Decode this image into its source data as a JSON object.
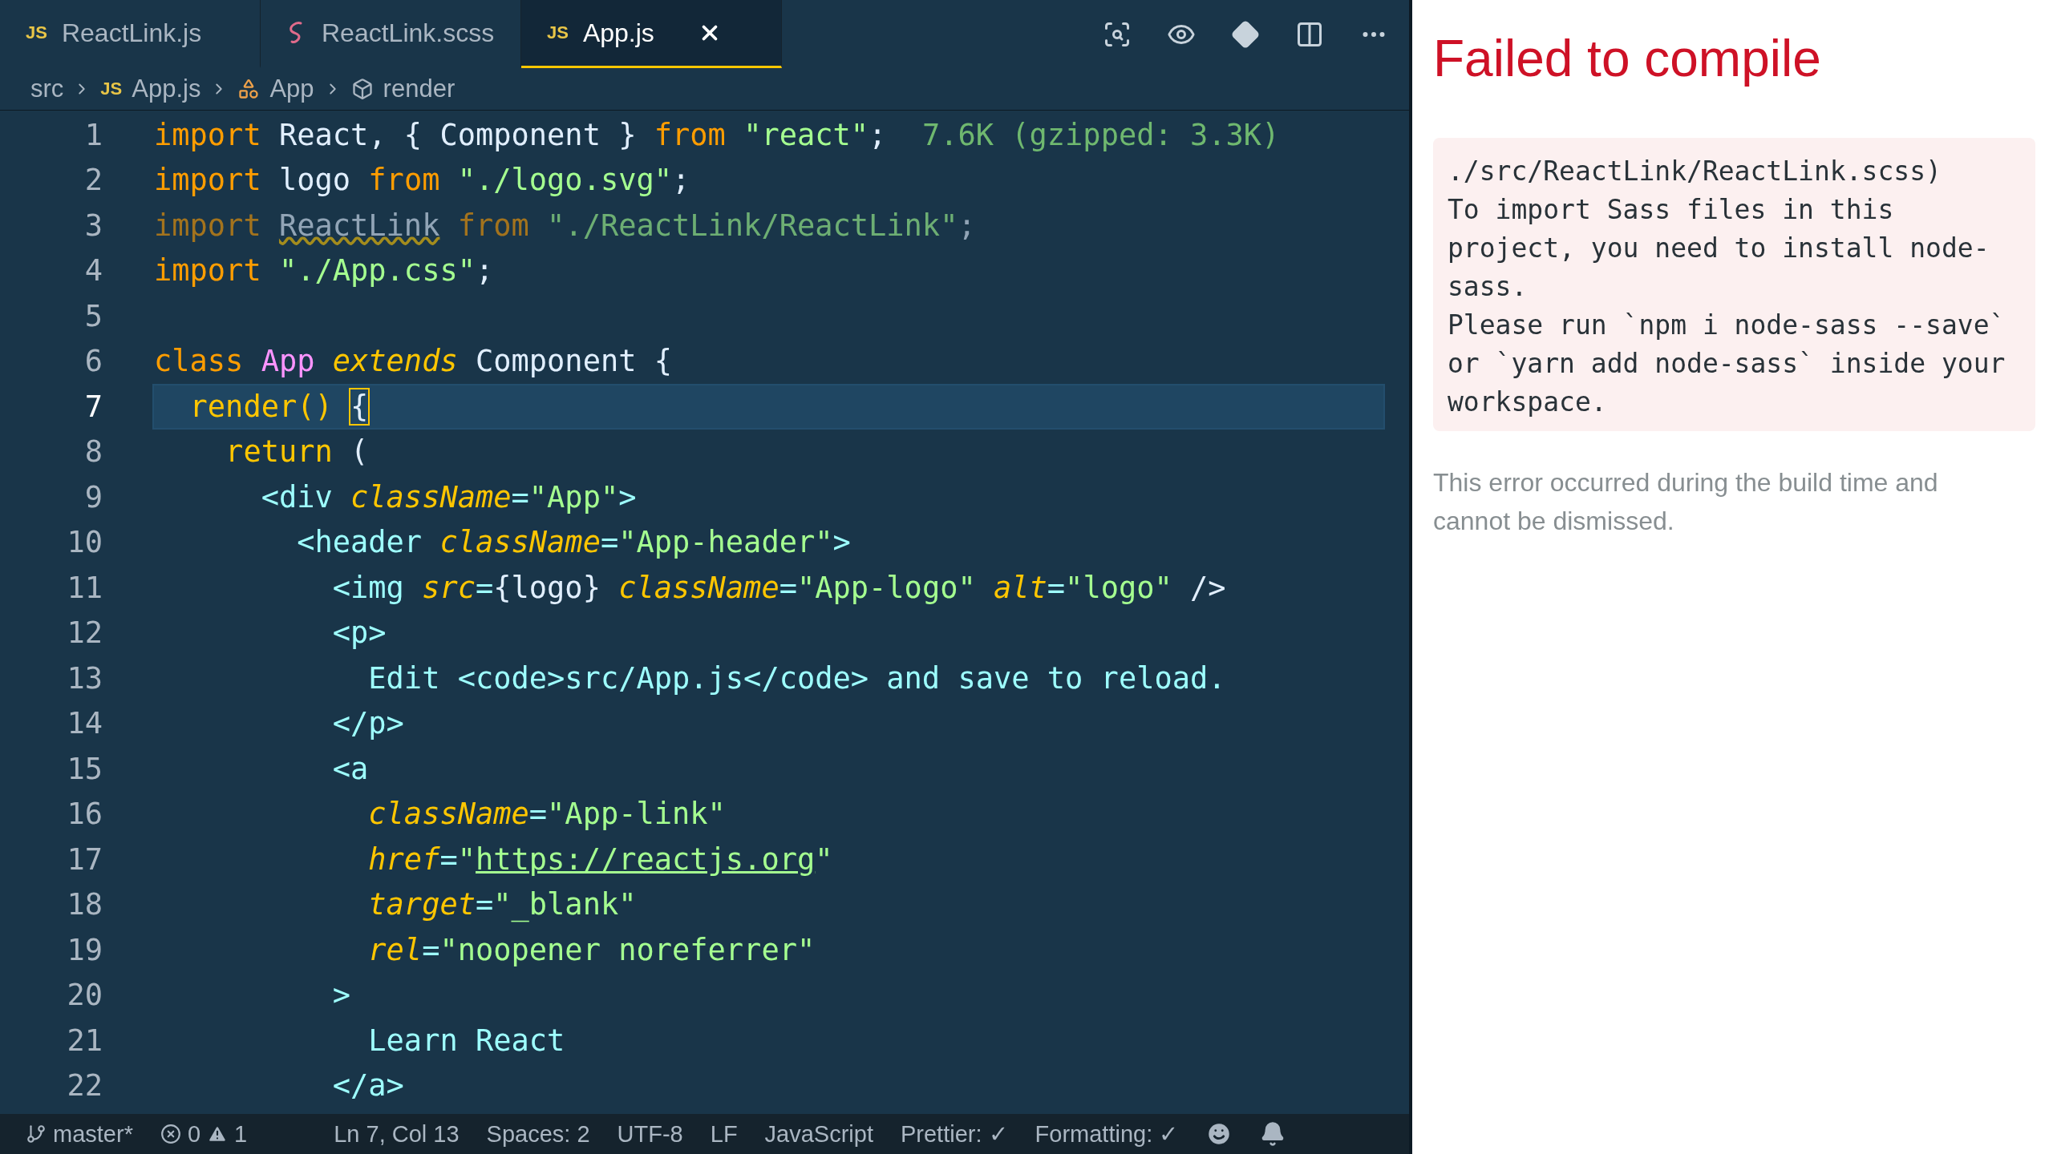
{
  "tabs": [
    {
      "label": "ReactLink.js",
      "kind": "js",
      "icon_text": "JS",
      "selected": false
    },
    {
      "label": "ReactLink.scss",
      "kind": "sass",
      "selected": false
    },
    {
      "label": "App.js",
      "kind": "js",
      "icon_text": "JS",
      "selected": true
    }
  ],
  "breadcrumb": [
    {
      "label": "src",
      "kind": "folder"
    },
    {
      "label": "App.js",
      "kind": "js",
      "icon_text": "JS"
    },
    {
      "label": "App",
      "kind": "class"
    },
    {
      "label": "render",
      "kind": "method"
    }
  ],
  "lines": [
    {
      "number": "1",
      "faded": false,
      "selected": false,
      "tokens": [
        {
          "kind": "kw",
          "text": "import "
        },
        {
          "kind": "id",
          "text": "React, { Component } "
        },
        {
          "kind": "kw",
          "text": "from "
        },
        {
          "kind": "str",
          "text": "\"react\""
        },
        {
          "kind": "id",
          "text": ";  "
        },
        {
          "kind": "size",
          "text": "7.6K (gzipped: 3.3K)"
        }
      ]
    },
    {
      "number": "2",
      "faded": false,
      "selected": false,
      "tokens": [
        {
          "kind": "kw",
          "text": "import "
        },
        {
          "kind": "id",
          "text": "logo "
        },
        {
          "kind": "kw",
          "text": "from "
        },
        {
          "kind": "str",
          "text": "\"./logo.svg\""
        },
        {
          "kind": "id",
          "text": ";"
        }
      ]
    },
    {
      "number": "3",
      "faded": true,
      "selected": false,
      "tokens": [
        {
          "kind": "kw",
          "text": "import "
        },
        {
          "kind": "warn",
          "text": "ReactLink"
        },
        {
          "kind": "kw",
          "text": " from "
        },
        {
          "kind": "str",
          "text": "\"./ReactLink/ReactLink\""
        },
        {
          "kind": "id",
          "text": ";"
        }
      ]
    },
    {
      "number": "4",
      "faded": false,
      "selected": false,
      "tokens": [
        {
          "kind": "kw",
          "text": "import "
        },
        {
          "kind": "str",
          "text": "\"./App.css\""
        },
        {
          "kind": "id",
          "text": ";"
        }
      ]
    },
    {
      "number": "5",
      "selected": false
    },
    {
      "number": "6",
      "faded": false,
      "selected": false,
      "tokens": [
        {
          "kind": "kw",
          "text": "class "
        },
        {
          "kind": "cls",
          "text": "App "
        },
        {
          "kind": "it",
          "text": "extends "
        },
        {
          "kind": "id",
          "text": "Component {"
        }
      ]
    },
    {
      "number": "7",
      "faded": false,
      "selected": true,
      "tokens": [
        {
          "kind": "fn",
          "text": "  render() "
        },
        {
          "kind": "match",
          "text": "{"
        }
      ]
    },
    {
      "number": "8",
      "faded": false,
      "selected": false,
      "tokens": [
        {
          "kind": "fn",
          "text": "    return "
        },
        {
          "kind": "id",
          "text": "("
        }
      ]
    },
    {
      "number": "9",
      "faded": false,
      "selected": false,
      "tokens": [
        {
          "kind": "tag",
          "text": "      <div "
        },
        {
          "kind": "attr",
          "text": "className"
        },
        {
          "kind": "tag",
          "text": "="
        },
        {
          "kind": "str",
          "text": "\"App\""
        },
        {
          "kind": "tag",
          "text": ">"
        }
      ]
    },
    {
      "number": "10",
      "faded": false,
      "selected": false,
      "tokens": [
        {
          "kind": "tag",
          "text": "        <header "
        },
        {
          "kind": "attr",
          "text": "className"
        },
        {
          "kind": "tag",
          "text": "="
        },
        {
          "kind": "str",
          "text": "\"App-header\""
        },
        {
          "kind": "tag",
          "text": ">"
        }
      ]
    },
    {
      "number": "11",
      "faded": false,
      "selected": false,
      "tokens": [
        {
          "kind": "tag",
          "text": "          <img "
        },
        {
          "kind": "attr",
          "text": "src"
        },
        {
          "kind": "tag",
          "text": "="
        },
        {
          "kind": "id",
          "text": "{logo} "
        },
        {
          "kind": "attr",
          "text": "className"
        },
        {
          "kind": "tag",
          "text": "="
        },
        {
          "kind": "str",
          "text": "\"App-logo\" "
        },
        {
          "kind": "attr",
          "text": "alt"
        },
        {
          "kind": "tag",
          "text": "="
        },
        {
          "kind": "str",
          "text": "\"logo\" "
        },
        {
          "kind": "id",
          "text": "/>"
        }
      ]
    },
    {
      "number": "12",
      "faded": false,
      "selected": false,
      "tokens": [
        {
          "kind": "tag",
          "text": "          <p>"
        }
      ]
    },
    {
      "number": "13",
      "faded": false,
      "selected": false,
      "tokens": [
        {
          "kind": "tag",
          "text": "            Edit <code>src/App.js</code> and save to reload."
        }
      ]
    },
    {
      "number": "14",
      "faded": false,
      "selected": false,
      "tokens": [
        {
          "kind": "tag",
          "text": "          </p>"
        }
      ]
    },
    {
      "number": "15",
      "faded": false,
      "selected": false,
      "tokens": [
        {
          "kind": "tag",
          "text": "          <a"
        }
      ]
    },
    {
      "number": "16",
      "faded": false,
      "selected": false,
      "tokens": [
        {
          "kind": "attr",
          "text": "            className"
        },
        {
          "kind": "tag",
          "text": "="
        },
        {
          "kind": "str",
          "text": "\"App-link\""
        }
      ]
    },
    {
      "number": "17",
      "faded": false,
      "selected": false,
      "tokens": [
        {
          "kind": "attr",
          "text": "            href"
        },
        {
          "kind": "tag",
          "text": "="
        },
        {
          "kind": "str",
          "text": "\""
        },
        {
          "kind": "link",
          "text": "https://reactjs.org"
        },
        {
          "kind": "str",
          "text": "\""
        }
      ]
    },
    {
      "number": "18",
      "faded": false,
      "selected": false,
      "tokens": [
        {
          "kind": "attr",
          "text": "            target"
        },
        {
          "kind": "tag",
          "text": "="
        },
        {
          "kind": "str",
          "text": "\"_blank\""
        }
      ]
    },
    {
      "number": "19",
      "faded": false,
      "selected": false,
      "tokens": [
        {
          "kind": "attr",
          "text": "            rel"
        },
        {
          "kind": "tag",
          "text": "="
        },
        {
          "kind": "str",
          "text": "\"noopener noreferrer\""
        }
      ]
    },
    {
      "number": "20",
      "faded": false,
      "selected": false,
      "tokens": [
        {
          "kind": "tag",
          "text": "          >"
        }
      ]
    },
    {
      "number": "21",
      "faded": false,
      "selected": false,
      "tokens": [
        {
          "kind": "tag",
          "text": "            Learn React"
        }
      ]
    },
    {
      "number": "22",
      "faded": false,
      "selected": false,
      "tokens": [
        {
          "kind": "tag",
          "text": "          </a>"
        }
      ]
    }
  ],
  "status_bar": {
    "branch": "master*",
    "errors": "0",
    "warnings": "1",
    "items": [
      "Ln 7, Col 13",
      "Spaces: 2",
      "UTF-8",
      "LF",
      "JavaScript",
      "Prettier: ✓",
      "Formatting: ✓"
    ]
  },
  "error_overlay": {
    "title": "Failed to compile",
    "message": "./src/ReactLink/ReactLink.scss)\nTo import Sass files in this project, you need to install node-sass.\nPlease run `npm i node-sass --save` or `yarn add node-sass` inside your workspace.",
    "footer": "This error occurred during the build time and cannot be dismissed."
  }
}
